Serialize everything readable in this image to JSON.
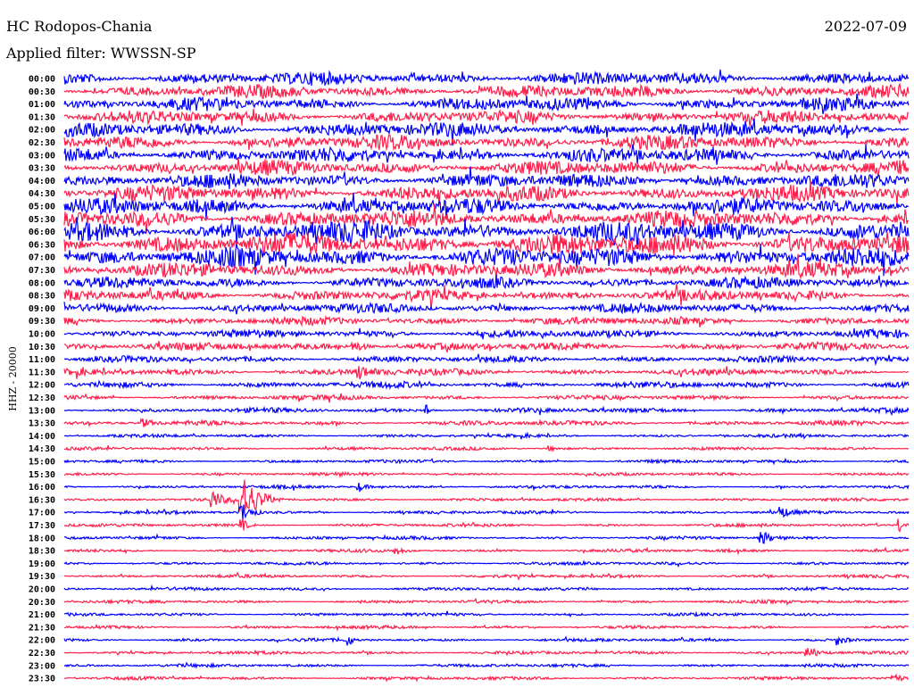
{
  "header": {
    "station": "HC Rodopos-Chania",
    "filter": "Applied filter: WWSSN-SP",
    "date": "2022-07-09"
  },
  "chart_data": {
    "type": "line",
    "title": "HC Rodopos-Chania",
    "ylabel": "HHZ - 20000",
    "row_minutes": 30,
    "row_labels": [
      "00:00",
      "00:30",
      "01:00",
      "01:30",
      "02:00",
      "02:30",
      "03:00",
      "03:30",
      "04:00",
      "04:30",
      "05:00",
      "05:30",
      "06:00",
      "06:30",
      "07:00",
      "07:30",
      "08:00",
      "08:30",
      "09:00",
      "09:30",
      "10:00",
      "10:30",
      "11:00",
      "11:30",
      "12:00",
      "12:30",
      "13:00",
      "13:30",
      "14:00",
      "14:30",
      "15:00",
      "15:30",
      "16:00",
      "16:30",
      "17:00",
      "17:30",
      "18:00",
      "18:30",
      "19:00",
      "19:30",
      "20:00",
      "20:30",
      "21:00",
      "21:30",
      "22:00",
      "22:30",
      "23:00",
      "23:30"
    ],
    "colors": [
      "#0000ff",
      "#ff1f4b"
    ],
    "noise_level": [
      8,
      8,
      8,
      8,
      9,
      9,
      9,
      9,
      9,
      10,
      10,
      11,
      13,
      14,
      12,
      9,
      7,
      7,
      6,
      5,
      5,
      5,
      4,
      4,
      4,
      3,
      3,
      3,
      2,
      2,
      2,
      2,
      2,
      2,
      2,
      2,
      2,
      2,
      2,
      2,
      2,
      2,
      2,
      2,
      2,
      2,
      2,
      2
    ],
    "events": [
      {
        "row": 33,
        "minute": 6.3,
        "amplitude": 30,
        "duration": 1.5
      },
      {
        "row": 33,
        "minute": 5.3,
        "amplitude": 10,
        "duration": 0.8
      },
      {
        "row": 34,
        "minute": 6.3,
        "amplitude": 12,
        "duration": 0.8
      },
      {
        "row": 35,
        "minute": 6.3,
        "amplitude": 8,
        "duration": 0.5
      },
      {
        "row": 32,
        "minute": 10.5,
        "amplitude": 5,
        "duration": 0.6
      },
      {
        "row": 34,
        "minute": 25.5,
        "amplitude": 6,
        "duration": 0.6
      },
      {
        "row": 35,
        "minute": 29.7,
        "amplitude": 8,
        "duration": 0.4
      },
      {
        "row": 36,
        "minute": 24.8,
        "amplitude": 8,
        "duration": 0.8
      },
      {
        "row": 37,
        "minute": 11.8,
        "amplitude": 4,
        "duration": 0.7
      },
      {
        "row": 44,
        "minute": 10.1,
        "amplitude": 8,
        "duration": 0.3
      },
      {
        "row": 44,
        "minute": 27.5,
        "amplitude": 5,
        "duration": 0.7
      },
      {
        "row": 45,
        "minute": 26.4,
        "amplitude": 7,
        "duration": 1.0
      },
      {
        "row": 47,
        "minute": 29.5,
        "amplitude": 6,
        "duration": 0.5
      },
      {
        "row": 27,
        "minute": 2.8,
        "amplitude": 5,
        "duration": 0.8
      },
      {
        "row": 26,
        "minute": 12.9,
        "amplitude": 7,
        "duration": 0.2
      },
      {
        "row": 29,
        "minute": 17.2,
        "amplitude": 3,
        "duration": 0.8
      },
      {
        "row": 21,
        "minute": 10.3,
        "amplitude": 6,
        "duration": 1.2
      },
      {
        "row": 23,
        "minute": 10.5,
        "amplitude": 6,
        "duration": 1.5
      }
    ]
  }
}
